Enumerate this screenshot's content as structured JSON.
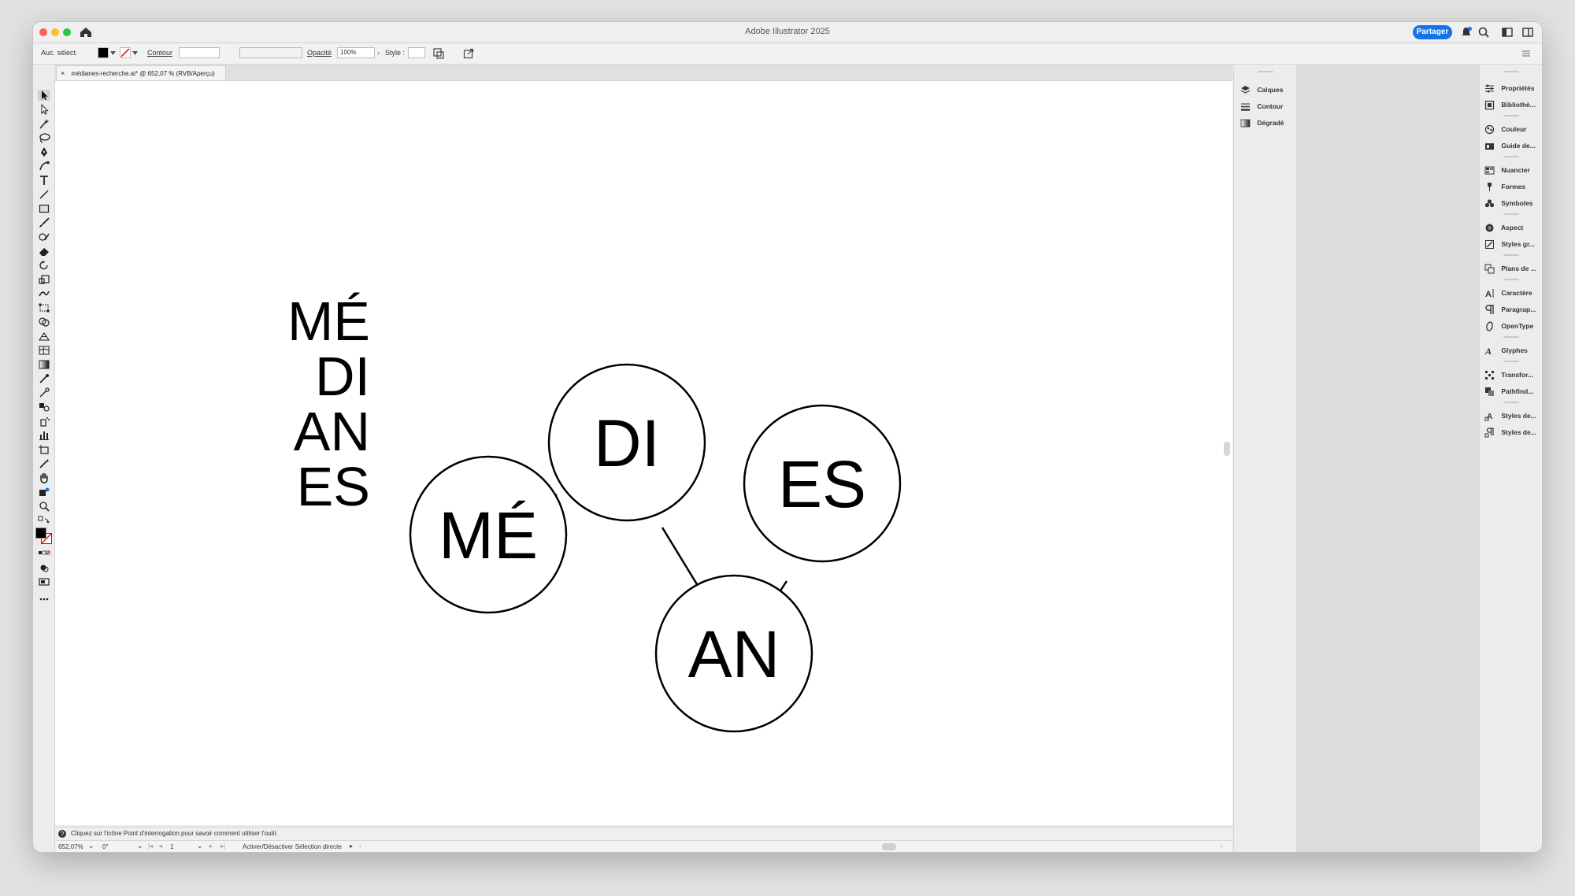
{
  "window": {
    "title": "Adobe Illustrator 2025",
    "share_label": "Partager"
  },
  "control_bar": {
    "selection": "Auc. sélect.",
    "stroke_label": "Contour",
    "opacity_label": "Opacité",
    "opacity_value": "100%",
    "style_label": "Style :"
  },
  "document_tab": {
    "close": "×",
    "label": "médianes-recherche.ai* @ 652,07 % (RVB/Aperçu)"
  },
  "artwork": {
    "stack_lines": [
      "MÉ",
      "DI",
      "AN",
      "ES"
    ],
    "circles": [
      "MÉ",
      "DI",
      "AN",
      "ES"
    ]
  },
  "status_bar": {
    "hint": "Cliquez sur l'icône Point d'interrogation pour savoir comment utiliser l'outil.",
    "zoom": "652,07%",
    "rotation": "0°",
    "artboard": "1",
    "toggle_label": "Activer/Désactiver Sélection directe"
  },
  "panels_left": [
    {
      "label": "Calques",
      "icon": "layers-icon"
    },
    {
      "label": "Contour",
      "icon": "stroke-icon"
    },
    {
      "label": "Dégradé",
      "icon": "gradient-icon"
    }
  ],
  "panels_right": [
    {
      "label": "Propriétés",
      "icon": "properties-icon"
    },
    {
      "label": "Bibliothè...",
      "icon": "libraries-icon"
    },
    {
      "label": "Couleur",
      "icon": "color-icon"
    },
    {
      "label": "Guide de...",
      "icon": "color-guide-icon"
    },
    {
      "label": "Nuancier",
      "icon": "swatches-icon"
    },
    {
      "label": "Formes",
      "icon": "brushes-icon"
    },
    {
      "label": "Symboles",
      "icon": "symbols-icon"
    },
    {
      "label": "Aspect",
      "icon": "appearance-icon"
    },
    {
      "label": "Styles gr...",
      "icon": "graphic-styles-icon"
    },
    {
      "label": "Plans de ...",
      "icon": "artboards-icon"
    },
    {
      "label": "Caractère",
      "icon": "character-icon"
    },
    {
      "label": "Paragrap...",
      "icon": "paragraph-icon"
    },
    {
      "label": "OpenType",
      "icon": "opentype-icon"
    },
    {
      "label": "Glyphes",
      "icon": "glyphs-icon"
    },
    {
      "label": "Transfor...",
      "icon": "transform-icon"
    },
    {
      "label": "Pathfind...",
      "icon": "pathfinder-icon"
    },
    {
      "label": "Styles de...",
      "icon": "character-styles-icon"
    },
    {
      "label": "Styles de...",
      "icon": "paragraph-styles-icon"
    }
  ],
  "colors": {
    "accent": "#1473e6",
    "canvas": "#ffffff",
    "ink": "#000000"
  }
}
